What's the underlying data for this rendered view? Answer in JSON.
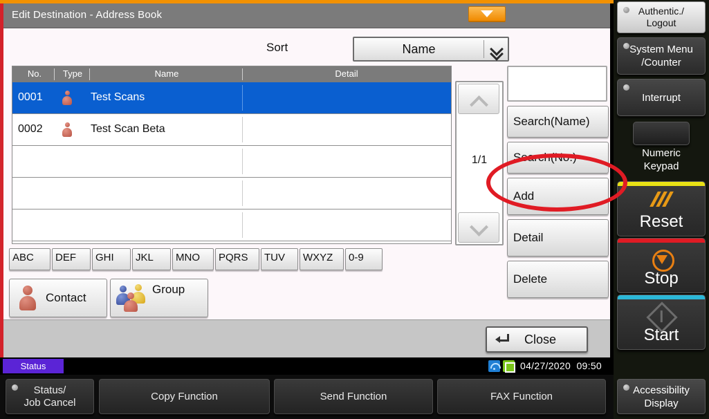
{
  "dialog": {
    "title": "Edit Destination - Address Book",
    "collapse_button": "collapse-triangle",
    "sort": {
      "label": "Sort",
      "value": "Name"
    },
    "table": {
      "headers": [
        "No.",
        "Type",
        "Name",
        "Detail"
      ],
      "rows": [
        {
          "no": "0001",
          "type": "contact",
          "name": "Test Scans",
          "detail": "",
          "selected": true
        },
        {
          "no": "0002",
          "type": "contact",
          "name": "Test Scan Beta",
          "detail": "",
          "selected": false
        },
        {
          "no": "",
          "type": "",
          "name": "",
          "detail": "",
          "selected": false
        },
        {
          "no": "",
          "type": "",
          "name": "",
          "detail": "",
          "selected": false
        },
        {
          "no": "",
          "type": "",
          "name": "",
          "detail": "",
          "selected": false
        }
      ]
    },
    "pager": {
      "page_indicator": "1/1",
      "up": "scroll-up",
      "down": "scroll-down"
    },
    "side_buttons": {
      "search_field_value": "",
      "search_name": "Search(Name)",
      "search_no": "Search(No.)",
      "add": "Add",
      "detail": "Detail",
      "delete": "Delete"
    },
    "alpha_tabs": [
      "ABC",
      "DEF",
      "GHI",
      "JKL",
      "MNO",
      "PQRS",
      "TUV",
      "WXYZ",
      "0-9"
    ],
    "type_filters": {
      "contact": "Contact",
      "group": "Group"
    },
    "close": "Close"
  },
  "status_bar": {
    "status_label": "Status",
    "date": "04/27/2020",
    "time": "09:50",
    "icons": [
      "wifi-icon",
      "network-icon"
    ]
  },
  "bottom_keys": [
    {
      "label_line1": "Status/",
      "label_line2": "Job Cancel",
      "has_led": true
    },
    {
      "label_line1": "Copy Function",
      "label_line2": "",
      "has_led": false
    },
    {
      "label_line1": "Send Function",
      "label_line2": "",
      "has_led": false
    },
    {
      "label_line1": "FAX Function",
      "label_line2": "",
      "has_led": false
    }
  ],
  "right_panel": {
    "authentication": {
      "line1": "Authentic./",
      "line2": "Logout"
    },
    "system_menu": {
      "line1": "System Menu",
      "line2": "/Counter"
    },
    "interrupt": {
      "line1": "Interrupt",
      "line2": ""
    },
    "numeric_keypad": {
      "line1": "Numeric",
      "line2": "Keypad"
    },
    "reset": "Reset",
    "stop": "Stop",
    "start": "Start",
    "accessibility": {
      "line1": "Accessibility",
      "line2": "Display"
    }
  },
  "colors": {
    "top_strip": "#f29100",
    "left_strip": "#d3222a",
    "title_bar": "#7b7b7b",
    "row_selected": "#0a5fd0",
    "status_chip": "#5b24d6",
    "annotation": "#e01b24",
    "reset_bar": "#e8e115",
    "stop_bar": "#e01b24",
    "start_bar": "#2bb8d8"
  },
  "annotation": {
    "shape": "ellipse",
    "target": "add-button"
  }
}
